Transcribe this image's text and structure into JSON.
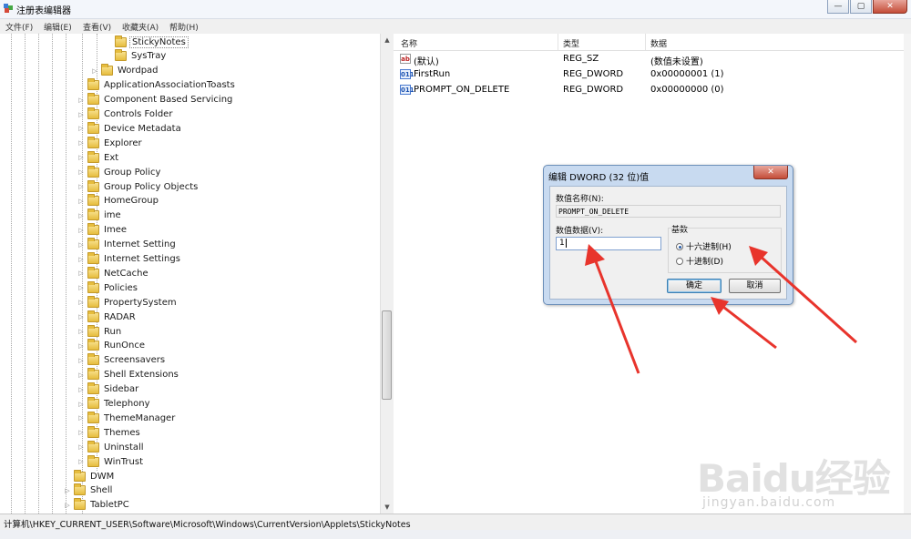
{
  "window": {
    "title": "注册表编辑器",
    "buttons": {
      "minimize": "—",
      "maximize": "▢",
      "close": "✕"
    }
  },
  "menu": [
    "文件(F)",
    "编辑(E)",
    "查看(V)",
    "收藏夹(A)",
    "帮助(H)"
  ],
  "tree": [
    {
      "label": "StickyNotes",
      "selected": true,
      "expandable": false
    },
    {
      "label": "SysTray",
      "expandable": false
    },
    {
      "label": "Wordpad",
      "expandable": true
    },
    {
      "label": "ApplicationAssociationToasts",
      "expandable": false
    },
    {
      "label": "Component Based Servicing",
      "expandable": true
    },
    {
      "label": "Controls Folder",
      "expandable": true
    },
    {
      "label": "Device Metadata",
      "expandable": true
    },
    {
      "label": "Explorer",
      "expandable": true
    },
    {
      "label": "Ext",
      "expandable": true
    },
    {
      "label": "Group Policy",
      "expandable": true
    },
    {
      "label": "Group Policy Objects",
      "expandable": true
    },
    {
      "label": "HomeGroup",
      "expandable": true
    },
    {
      "label": "ime",
      "expandable": true
    },
    {
      "label": "Imee",
      "expandable": true
    },
    {
      "label": "Internet Setting",
      "expandable": true
    },
    {
      "label": "Internet Settings",
      "expandable": true
    },
    {
      "label": "NetCache",
      "expandable": true
    },
    {
      "label": "Policies",
      "expandable": true
    },
    {
      "label": "PropertySystem",
      "expandable": true
    },
    {
      "label": "RADAR",
      "expandable": true
    },
    {
      "label": "Run",
      "expandable": true
    },
    {
      "label": "RunOnce",
      "expandable": true
    },
    {
      "label": "Screensavers",
      "expandable": true
    },
    {
      "label": "Shell Extensions",
      "expandable": true
    },
    {
      "label": "Sidebar",
      "expandable": true
    },
    {
      "label": "Telephony",
      "expandable": true
    },
    {
      "label": "ThemeManager",
      "expandable": true
    },
    {
      "label": "Themes",
      "expandable": true
    },
    {
      "label": "Uninstall",
      "expandable": true
    },
    {
      "label": "WinTrust",
      "expandable": true
    },
    {
      "label": "DWM",
      "expandable": false
    },
    {
      "label": "Shell",
      "expandable": true
    },
    {
      "label": "TabletPC",
      "expandable": true
    }
  ],
  "list": {
    "headers": {
      "name": "名称",
      "type": "类型",
      "data": "数据"
    },
    "rows": [
      {
        "icon": "ab",
        "name": "(默认)",
        "type": "REG_SZ",
        "data": "(数值未设置)"
      },
      {
        "icon": "011",
        "name": "FirstRun",
        "type": "REG_DWORD",
        "data": "0x00000001 (1)"
      },
      {
        "icon": "011",
        "name": "PROMPT_ON_DELETE",
        "type": "REG_DWORD",
        "data": "0x00000000 (0)"
      }
    ]
  },
  "dialog": {
    "title": "编辑 DWORD (32 位)值",
    "close": "✕",
    "name_label": "数值名称(N):",
    "name_value": "PROMPT_ON_DELETE",
    "data_label": "数值数据(V):",
    "data_value": "1",
    "base_label": "基数",
    "radio_hex": "十六进制(H)",
    "radio_dec": "十进制(D)",
    "selected_base": "hex",
    "ok": "确定",
    "cancel": "取消"
  },
  "status": "计算机\\HKEY_CURRENT_USER\\Software\\Microsoft\\Windows\\CurrentVersion\\Applets\\StickyNotes",
  "watermark": {
    "brand": "Baidu经验",
    "url": "jingyan.baidu.com"
  },
  "colors": {
    "annotation_arrow": "#e8342c",
    "folder": "#e6bd3e",
    "dialog_frame": "#c8daf0"
  }
}
